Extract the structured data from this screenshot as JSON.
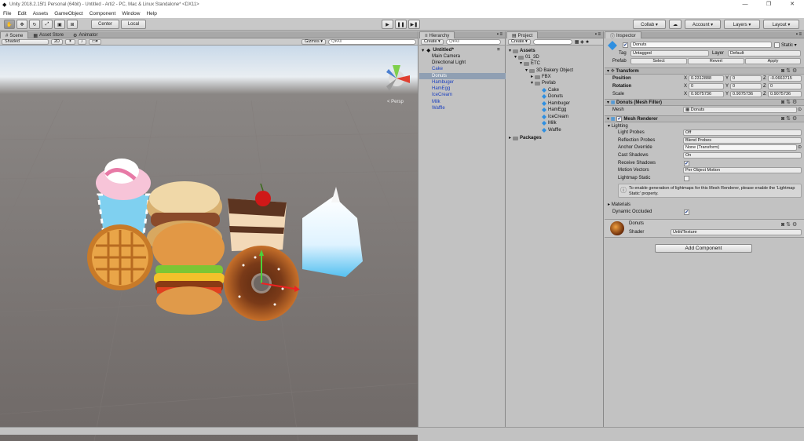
{
  "window": {
    "title": "Unity 2018.2.15f1 Personal (64bit) - Untitled - Arti2 - PC, Mac & Linux Standalone* <DX11>",
    "min": "—",
    "max": "❐",
    "close": "✕"
  },
  "menu": [
    "File",
    "Edit",
    "Assets",
    "GameObject",
    "Component",
    "Window",
    "Help"
  ],
  "toolbar": {
    "pivot": "Center",
    "space": "Local",
    "collab": "Collab ▾",
    "account": "Account ▾",
    "layers": "Layers ▾",
    "layout": "Layout ▾"
  },
  "scene": {
    "tabs": [
      "Scene",
      "Asset Store",
      "Animator"
    ],
    "shading": "Shaded",
    "mode2d": "2D",
    "gizmos": "Gizmos ▾",
    "search_placeholder": "Q▾All",
    "persp": "< Persp"
  },
  "hierarchy": {
    "tab": "Hierarchy",
    "create": "Create ▾",
    "search_placeholder": "Q▾All",
    "root": "Untitled*",
    "items": [
      "Main Camera",
      "Directional Light",
      "Cake",
      "Donuts",
      "Hambuger",
      "HamEgg",
      "IceCream",
      "Milk",
      "Waffle"
    ],
    "selected_index": 3
  },
  "project": {
    "tab": "Project",
    "create": "Create ▾",
    "assets": "Assets",
    "f1": "01_3D",
    "f2": "ETC",
    "f3": "3D Bakery Object",
    "fbx": "FBX",
    "prefab": "Prefab",
    "prefabs": [
      "Cake",
      "Donuts",
      "Hambuger",
      "HamEgg",
      "IceCream",
      "Milk",
      "Waffle"
    ],
    "packages": "Packages"
  },
  "inspector": {
    "tab": "Inspector",
    "object_name": "Donuts",
    "static_label": "Static ▾",
    "tag_label": "Tag",
    "tag_value": "Untagged",
    "layer_label": "Layer",
    "layer_value": "Default",
    "prefab_label": "Prefab",
    "prefab_select": "Select",
    "prefab_revert": "Revert",
    "prefab_apply": "Apply",
    "transform": {
      "title": "Transform",
      "position_label": "Position",
      "position": {
        "x": "0.2312888",
        "y": "0",
        "z": "-0.0663715"
      },
      "rotation_label": "Rotation",
      "rotation": {
        "x": "0",
        "y": "0",
        "z": "0"
      },
      "scale_label": "Scale",
      "scale": {
        "x": "0.9075736",
        "y": "0.9075736",
        "z": "0.9075736"
      }
    },
    "mesh_filter": {
      "title": "Donuts (Mesh Filter)",
      "mesh_label": "Mesh",
      "mesh_value": "Donuts"
    },
    "mesh_renderer": {
      "title": "Mesh Renderer",
      "lighting": "Lighting",
      "light_probes_label": "Light Probes",
      "light_probes": "Off",
      "reflection_probes_label": "Reflection Probes",
      "reflection_probes": "Blend Probes",
      "anchor_override_label": "Anchor Override",
      "anchor_override": "None (Transform)",
      "cast_shadows_label": "Cast Shadows",
      "cast_shadows": "On",
      "receive_shadows_label": "Receive Shadows",
      "motion_vectors_label": "Motion Vectors",
      "motion_vectors": "Per Object Motion",
      "lightmap_static_label": "Lightmap Static",
      "info": "To enable generation of lightmaps for this Mesh Renderer, please enable the 'Lightmap Static' property.",
      "materials": "Materials",
      "dynamic_occluded_label": "Dynamic Occluded"
    },
    "material": {
      "name": "Donuts",
      "shader_label": "Shader",
      "shader_value": "Unlit/Texture"
    },
    "add_component": "Add Component"
  },
  "colors": {
    "selection": "#8f9fb3",
    "prefab_text": "#1a3fbf",
    "icon_blue": "#2f8fe0"
  }
}
